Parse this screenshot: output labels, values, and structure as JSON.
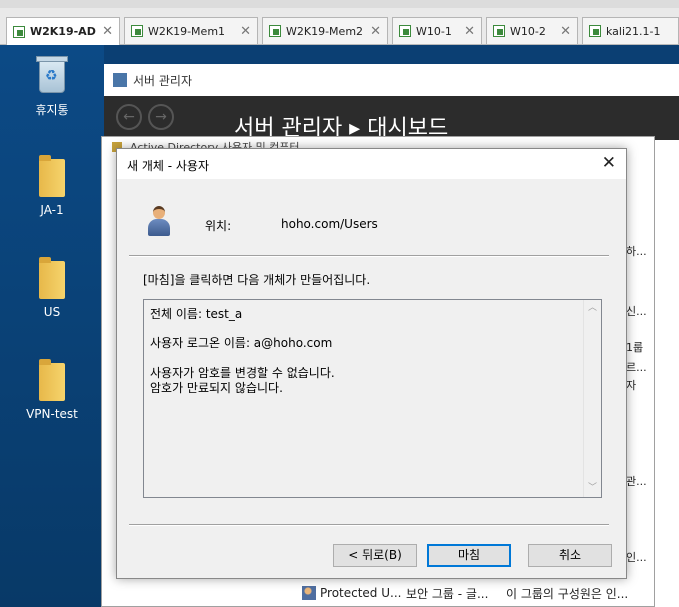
{
  "vm_tabs": [
    {
      "title": "W2K19-AD",
      "active": true
    },
    {
      "title": "W2K19-Mem1",
      "active": false
    },
    {
      "title": "W2K19-Mem2",
      "active": false
    },
    {
      "title": "W10-1",
      "active": false
    },
    {
      "title": "W10-2",
      "active": false
    },
    {
      "title": "kali21.1-1",
      "active": false
    }
  ],
  "desktop_icons": [
    "휴지통",
    "JA-1",
    "US",
    "VPN-test"
  ],
  "server_manager": {
    "title": "서버 관리자",
    "breadcrumb": "서버 관리자 ▸ 대시보드"
  },
  "ad_window": {
    "title": "Active Directory 사용자 및 컴퓨터",
    "row": {
      "name": "Protected U...",
      "type": "보안 그룹 - 글...",
      "description": "이 그룹의 구성원은 인..."
    },
    "fragments": [
      "하...",
      "신...",
      "1룹",
      "르...",
      "자",
      "관...",
      "인..."
    ]
  },
  "dialog": {
    "title": "새 개체 - 사용자",
    "close_glyph": "✕",
    "location_label": "위치:",
    "location_value": "hoho.com/Users",
    "intro": "[마침]을 클릭하면 다음 개체가 만들어집니다.",
    "summary_lines": [
      "전체 이름: test_a",
      "",
      "사용자 로그온 이름: a@hoho.com",
      "",
      "사용자가 암호를 변경할 수 없습니다.",
      "암호가 만료되지 않습니다."
    ],
    "buttons": {
      "back": "< 뒤로(B)",
      "finish": "마침",
      "cancel": "취소"
    }
  }
}
